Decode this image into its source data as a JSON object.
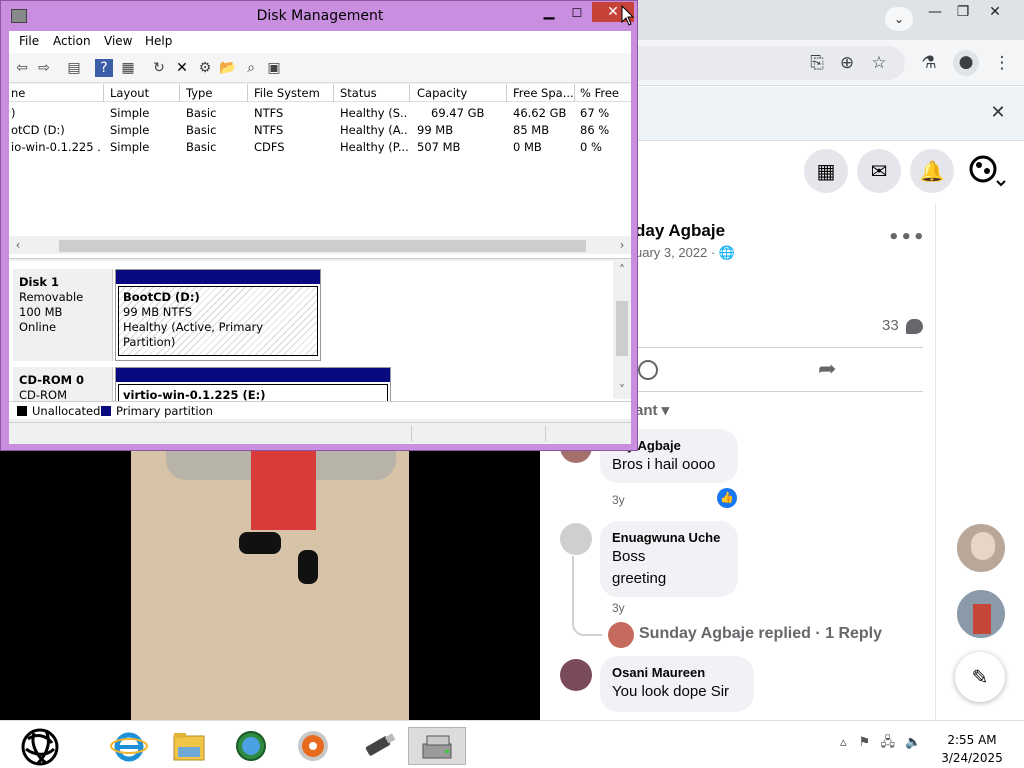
{
  "browser": {
    "tabbar": {
      "tab_search_icon": "chevron-down-icon",
      "minimize_glyph": "—",
      "maximize_glyph": "❐",
      "close_glyph": "✕"
    },
    "toolbar_icons": [
      "install-icon",
      "zoom-icon",
      "bookmark-star-icon",
      "labs-flask-icon",
      "profile-icon",
      "more-vert-icon"
    ],
    "infobar_close_glyph": "✕"
  },
  "facebook": {
    "post": {
      "author": "day Agbaje",
      "date": "uary 3, 2022 · ",
      "comment_count": "33"
    },
    "sort_label": "ant ▾",
    "comments": [
      {
        "name": "day Agbaje",
        "text": [
          "Bros i hail oooo"
        ],
        "time": "3y",
        "reaction": "like"
      },
      {
        "name": "Enuagwuna Uche",
        "text": [
          "Boss",
          "greeting"
        ],
        "time": "3y"
      },
      {
        "name": "Osani Maureen",
        "text": [
          "You look dope Sir"
        ]
      }
    ],
    "reply_summary": "Sunday Agbaje replied · 1 Reply"
  },
  "disk_management": {
    "title": "Disk Management",
    "menu": [
      "File",
      "Action",
      "View",
      "Help"
    ],
    "columns": [
      "ne",
      "Layout",
      "Type",
      "File System",
      "Status",
      "Capacity",
      "Free Spa...",
      "% Free"
    ],
    "volumes": [
      [
        ")",
        "Simple",
        "Basic",
        "NTFS",
        "Healthy (S...",
        "69.47 GB",
        "46.62 GB",
        "67 %"
      ],
      [
        "otCD (D:)",
        "Simple",
        "Basic",
        "NTFS",
        "Healthy (A...",
        "99 MB",
        "85 MB",
        "86 %"
      ],
      [
        "io-win-0.1.225 ...",
        "Simple",
        "Basic",
        "CDFS",
        "Healthy (P...",
        "507 MB",
        "0 MB",
        "0 %"
      ]
    ],
    "disks": [
      {
        "name": "Disk 1",
        "lines": [
          "Removable",
          "100 MB",
          "Online"
        ],
        "partition": {
          "name": "BootCD  (D:)",
          "lines": [
            "99 MB NTFS",
            "Healthy (Active, Primary Partition)"
          ]
        }
      },
      {
        "name": "CD-ROM 0",
        "lines": [
          "CD-ROM"
        ],
        "partition": {
          "name": "virtio-win-0.1.225  (E:)",
          "lines": []
        }
      }
    ],
    "legend": [
      {
        "label": "Unallocated",
        "color": "#000000"
      },
      {
        "label": "Primary partition",
        "color": "#0a0a80"
      }
    ]
  },
  "taskbar": {
    "apps": [
      "internet-explorer",
      "file-explorer",
      "network-globe",
      "media-disc",
      "usb-drive",
      "disk-management"
    ],
    "clock_time": "2:55 AM",
    "clock_date": "3/24/2025"
  },
  "colors": {
    "window_frame": "#c98ee0",
    "close_button": "#c7433a",
    "primary_partition": "#0a0a80",
    "facebook_like": "#1877f2"
  }
}
